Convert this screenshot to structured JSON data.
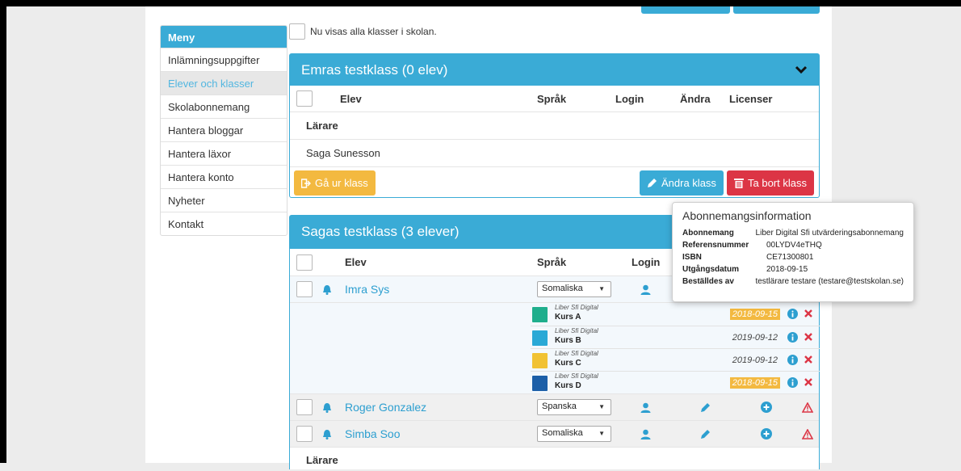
{
  "menu": {
    "title": "Meny",
    "items": [
      {
        "label": "Inlämningsuppgifter"
      },
      {
        "label": "Elever och klasser"
      },
      {
        "label": "Skolabonnemang"
      },
      {
        "label": "Hantera bloggar"
      },
      {
        "label": "Hantera läxor"
      },
      {
        "label": "Hantera konto"
      },
      {
        "label": "Nyheter"
      },
      {
        "label": "Kontakt"
      }
    ]
  },
  "notice": {
    "label": "Nu visas alla klasser i skolan."
  },
  "colors": {
    "accent": "#3aabd6",
    "warning": "#f3b940",
    "danger": "#dc3545",
    "link": "#2d9fd0"
  },
  "class1": {
    "title": "Emras testklass (0 elev)",
    "headers": {
      "elev": "Elev",
      "sprak": "Språk",
      "login": "Login",
      "andra": "Ändra",
      "licenser": "Licenser"
    },
    "teachers_label": "Lärare",
    "teacher": "Saga Sunesson",
    "leave_button": "Gå ur klass",
    "edit_button": "Ändra klass",
    "delete_button": "Ta bort klass"
  },
  "class2": {
    "title": "Sagas testklass (3 elever)",
    "headers": {
      "elev": "Elev",
      "sprak": "Språk",
      "login": "Login"
    },
    "students": [
      {
        "name": "Imra Sys",
        "language": "Somaliska"
      },
      {
        "name": "Roger Gonzalez",
        "language": "Spanska"
      },
      {
        "name": "Simba Soo",
        "language": "Somaliska"
      }
    ],
    "products": [
      {
        "publisher": "Liber Sfi Digital",
        "name": "Kurs A",
        "date": "2018-09-15",
        "expired": true,
        "color": "#1fae8c"
      },
      {
        "publisher": "Liber Sfi Digital",
        "name": "Kurs B",
        "date": "2019-09-12",
        "expired": false,
        "color": "#2aa9d6"
      },
      {
        "publisher": "Liber Sfi Digital",
        "name": "Kurs C",
        "date": "2019-09-12",
        "expired": false,
        "color": "#f1c232"
      },
      {
        "publisher": "Liber Sfi Digital",
        "name": "Kurs D",
        "date": "2018-09-15",
        "expired": true,
        "color": "#1c5fa8"
      }
    ],
    "teachers_label": "Lärare"
  },
  "tooltip": {
    "title": "Abonnemangsinformation",
    "rows": [
      {
        "key": "Abonnemang",
        "value": "Liber Digital Sfi utvärderingsabonnemang"
      },
      {
        "key": "Referensnummer",
        "value": "00LYDV4eTHQ"
      },
      {
        "key": "ISBN",
        "value": "CE71300801"
      },
      {
        "key": "Utgångsdatum",
        "value": "2018-09-15"
      },
      {
        "key": "Beställdes av",
        "value": "testlärare testare (testare@testskolan.se)"
      }
    ]
  }
}
